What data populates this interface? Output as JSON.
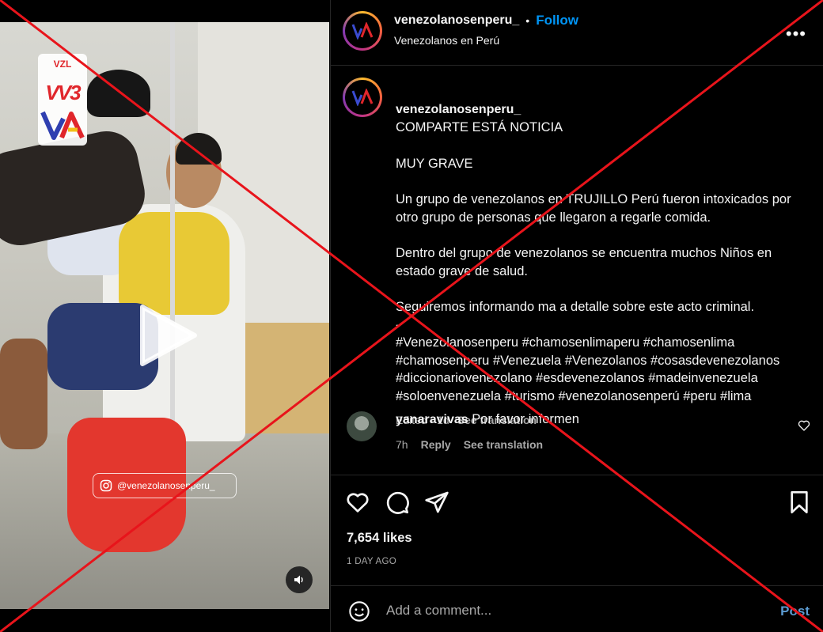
{
  "post": {
    "username": "venezolanosenperu_",
    "follow_label": "Follow",
    "dot": "•",
    "location": "Venezolanos en Perú",
    "more_label": "•••"
  },
  "caption": {
    "username": "venezolanosenperu_",
    "headline": "COMPARTE ESTÁ NOTICIA",
    "lines": [
      "MUY GRAVE",
      "Un grupo de venezolanos en TRUJILLO Perú fueron intoxicados por otro grupo de personas que llegaron a regarle comida.",
      "Dentro del grupo de venezolanos se encuentra muchos Niños en estado grave de salud.",
      "Seguiremos informando ma a detalle sobre este acto criminal.\n-\n#Venezolanosenperu #chamosenlimaperu #chamosenlima #chamosenperu #Venezuela #Venezolanos #cosasdevenezolanos #diccionariovenezolano #esdevenezolanos #madeinvenezuela #soloenvenezuela #turismo #venezolanosenperú #peru #lima"
    ],
    "edited": "Edited · 1d",
    "see_translation": "See translation"
  },
  "comment": {
    "username": "yanaravivas",
    "text": "Por favor informen",
    "time": "7h",
    "reply": "Reply",
    "see_translation": "See translation"
  },
  "actions": {
    "likes": "7,654 likes",
    "date": "1 DAY AGO"
  },
  "add_comment": {
    "placeholder": "Add a comment...",
    "post_label": "Post"
  },
  "video": {
    "watermark": "@venezolanosenperu_",
    "logo_top": "VZL",
    "logo_mid": "VV3"
  },
  "colors": {
    "accent": "#0095f6",
    "cross": "#e8141b",
    "secondary_text": "#a8a8a8"
  }
}
